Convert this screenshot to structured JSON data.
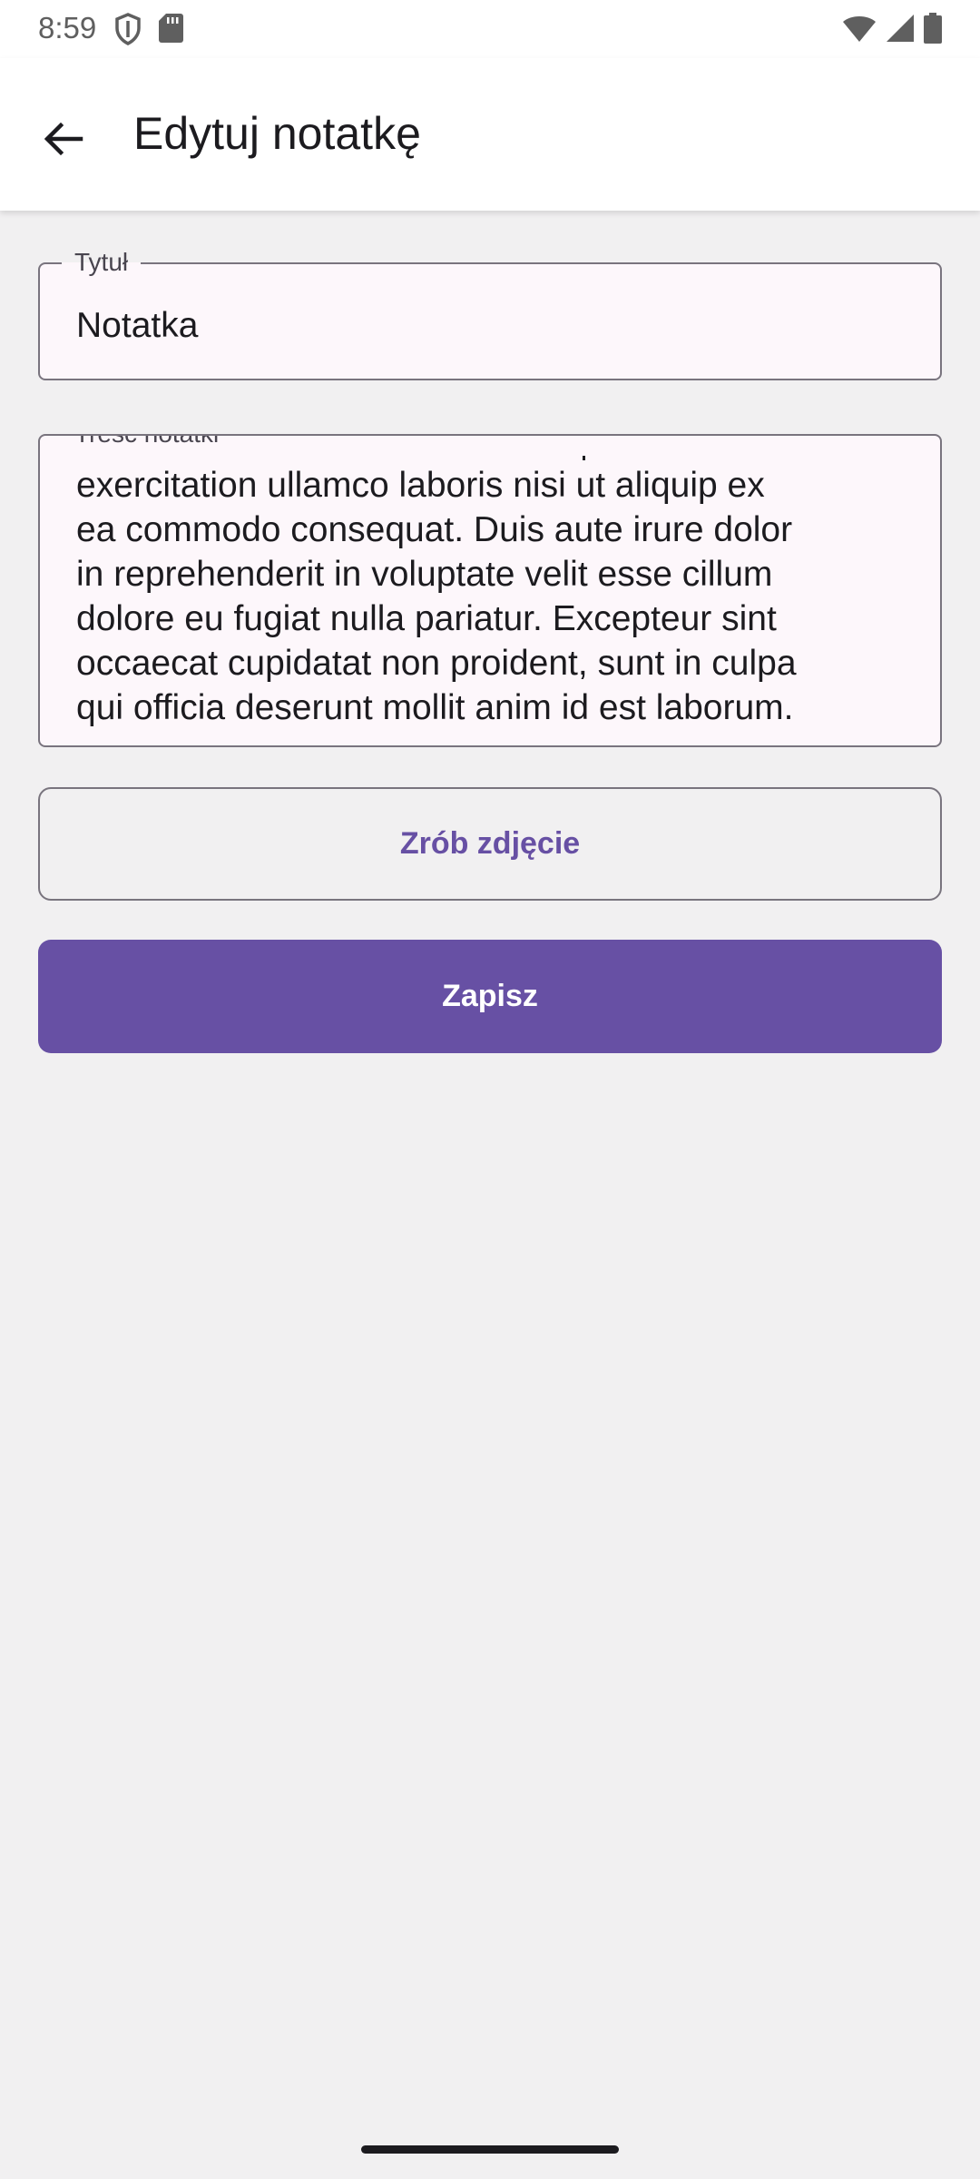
{
  "status_bar": {
    "time": "8:59",
    "icons": [
      "shield-icon",
      "sd-card-icon",
      "wifi-icon",
      "signal-icon",
      "battery-icon"
    ]
  },
  "app_bar": {
    "back_icon": "arrow-back-icon",
    "title": "Edytuj notatkę"
  },
  "form": {
    "title_field": {
      "label": "Tytuł",
      "value": "Notatka"
    },
    "content_field": {
      "label": "Treść notatki",
      "value": "exercitation ullamco laboris nisi ut aliquip ex\nea commodo consequat. Duis aute irure dolor\nin reprehenderit in voluptate velit esse cillum\ndolore eu fugiat nulla pariatur. Excepteur sint\noccaecat cupidatat non proident, sunt in culpa\nqui officia deserunt mollit anim id est laborum."
    },
    "photo_button": "Zrób zdjęcie",
    "save_button": "Zapisz"
  },
  "colors": {
    "primary": "#6750a4",
    "background": "#f1f0f1",
    "field_fill": "#fdf7fb",
    "outline": "#79747e"
  }
}
